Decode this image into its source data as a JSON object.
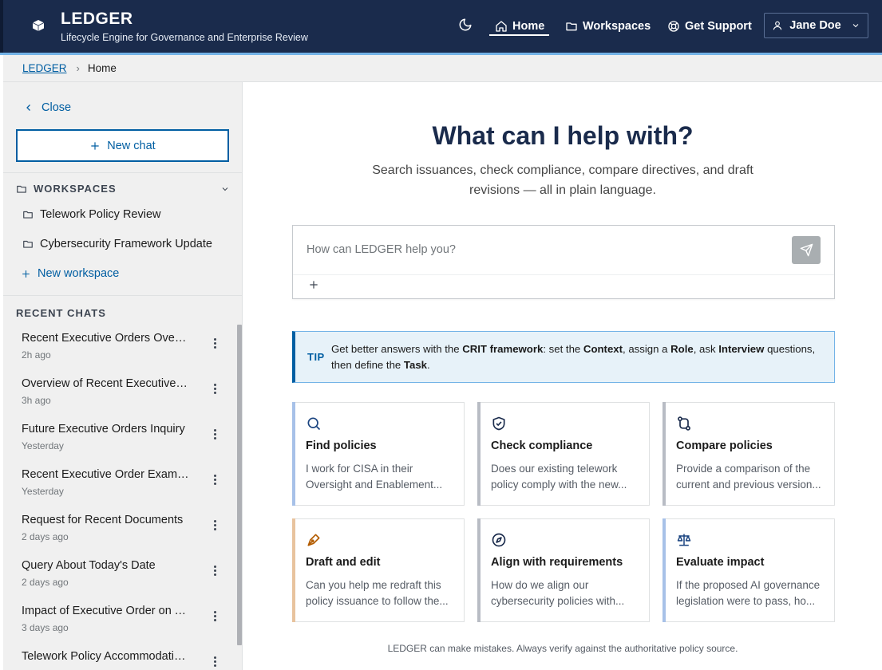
{
  "header": {
    "title": "LEDGER",
    "subtitle": "Lifecycle Engine for Governance and Enterprise Review",
    "nav": {
      "home": "Home",
      "workspaces": "Workspaces",
      "support": "Get Support"
    },
    "user": "Jane Doe"
  },
  "breadcrumb": {
    "root": "LEDGER",
    "current": "Home"
  },
  "sidebar": {
    "close": "Close",
    "new_chat": "New chat",
    "workspaces_heading": "WORKSPACES",
    "workspaces": [
      {
        "label": "Telework Policy Review"
      },
      {
        "label": "Cybersecurity Framework Update"
      }
    ],
    "new_workspace": "New workspace",
    "recent_heading": "RECENT CHATS",
    "chats": [
      {
        "title": "Recent Executive Orders Overview",
        "time": "2h ago"
      },
      {
        "title": "Overview of Recent Executive Orders",
        "time": "3h ago"
      },
      {
        "title": "Future Executive Orders Inquiry",
        "time": "Yesterday"
      },
      {
        "title": "Recent Executive Order Examples",
        "time": "Yesterday"
      },
      {
        "title": "Request for Recent Documents",
        "time": "2 days ago"
      },
      {
        "title": "Query About Today's Date",
        "time": "2 days ago"
      },
      {
        "title": "Impact of Executive Order on Telework",
        "time": "3 days ago"
      },
      {
        "title": "Telework Policy Accommodations",
        "time": ""
      }
    ]
  },
  "main": {
    "title": "What can I help with?",
    "subtitle": "Search issuances, check compliance, compare directives, and draft revisions — all in plain language.",
    "prompt_placeholder": "How can LEDGER help you?",
    "tip": {
      "label": "TIP",
      "t1": "Get better answers with the ",
      "b1": "CRIT framework",
      "t2": ": set the ",
      "b2": "Context",
      "t3": ", assign a ",
      "b3": "Role",
      "t4": ", ask ",
      "b4": "Interview",
      "t5": " questions,",
      "t6": "then define the ",
      "b5": "Task",
      "t7": "."
    },
    "cards": [
      {
        "title": "Find policies",
        "line1": "I work for CISA in their",
        "line2": "Oversight and Enablement...",
        "icon": "search-icon"
      },
      {
        "title": "Check compliance",
        "line1": "Does our existing telework",
        "line2": "policy comply with the new...",
        "icon": "shield-check-icon"
      },
      {
        "title": "Compare policies",
        "line1": "Provide a comparison of the",
        "line2": "current and previous version...",
        "icon": "compare-icon"
      },
      {
        "title": "Draft and edit",
        "line1": "Can you help me redraft this",
        "line2": "policy issuance to follow the...",
        "icon": "pen-icon"
      },
      {
        "title": "Align with requirements",
        "line1": "How do we align our",
        "line2": "cybersecurity policies with...",
        "icon": "compass-icon"
      },
      {
        "title": "Evaluate impact",
        "line1": "If the proposed AI governance",
        "line2": "legislation were to pass, ho...",
        "icon": "scale-icon"
      }
    ],
    "disclaimer": "LEDGER can make mistakes. Always verify against the authoritative policy source."
  },
  "colors": {
    "header_bg": "#1a2b4c",
    "accent": "#005ea2",
    "card_bar_blue": "#a7c1e8",
    "card_bar_orange": "#e8c39e",
    "card_bar_gray": "#b8bcc4"
  }
}
